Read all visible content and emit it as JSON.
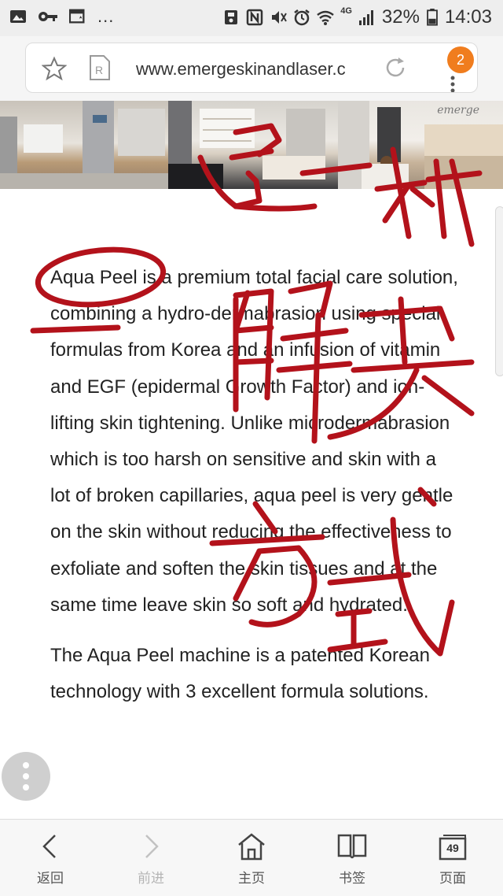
{
  "status_bar": {
    "more_indicator": "...",
    "network": "4G",
    "battery": "32%",
    "time": "14:03",
    "icons": [
      "image-icon",
      "key-icon",
      "calendar-icon",
      "save-icon",
      "nfc-icon",
      "mute-icon",
      "alarm-icon",
      "wifi-icon",
      "signal-icon",
      "battery-icon"
    ]
  },
  "browser": {
    "url": "www.emergeskinandlaser.c",
    "notification_count": "2",
    "photo_logo": "emerge"
  },
  "article": {
    "paragraphs": [
      "Aqua Peel is a premium total facial care solution, combining a hydro-dermabrasion using special formulas from Korea and an infusion of vitamin and EGF (epidermal Growth Factor) and ion-lifting skin tightening. Unlike microdermabrasion which is too harsh on sensitive and skin with a lot of broken capillaries, aqua peel is very gentle on the skin without reducing the effectiveness to exfoliate and soften the skin tissues and at the same time leave skin so soft and hydrated.",
      "The Aqua Peel machine is a patented Korean technology with 3 excellent formula solutions."
    ]
  },
  "bottom_nav": {
    "items": [
      {
        "label": "返回",
        "icon": "back-arrow-icon"
      },
      {
        "label": "前进",
        "icon": "forward-arrow-icon"
      },
      {
        "label": "主页",
        "icon": "home-icon"
      },
      {
        "label": "书签",
        "icon": "bookmarks-icon"
      },
      {
        "label": "页面",
        "icon": "tabs-icon",
        "count": "49"
      }
    ]
  },
  "colors": {
    "ink": "#b3121b",
    "badge": "#f07d1e",
    "status_bar": "#eeeeee"
  }
}
